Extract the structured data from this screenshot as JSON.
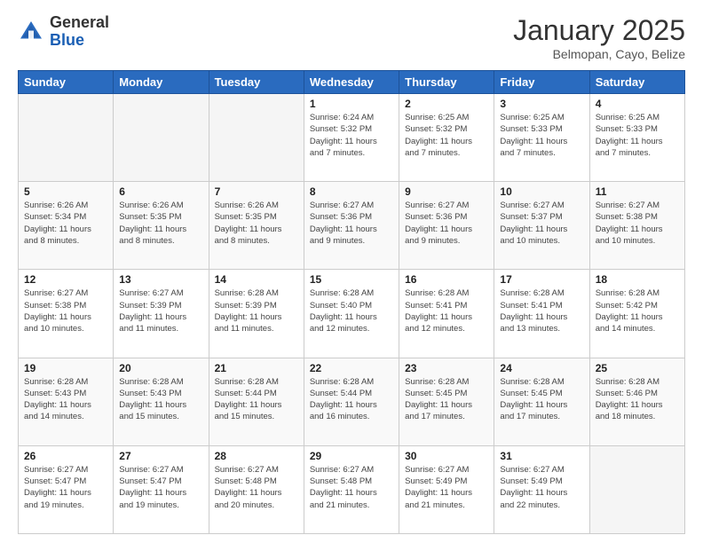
{
  "logo": {
    "general": "General",
    "blue": "Blue"
  },
  "title": "January 2025",
  "subtitle": "Belmopan, Cayo, Belize",
  "days_of_week": [
    "Sunday",
    "Monday",
    "Tuesday",
    "Wednesday",
    "Thursday",
    "Friday",
    "Saturday"
  ],
  "weeks": [
    [
      {
        "day": "",
        "info": ""
      },
      {
        "day": "",
        "info": ""
      },
      {
        "day": "",
        "info": ""
      },
      {
        "day": "1",
        "info": "Sunrise: 6:24 AM\nSunset: 5:32 PM\nDaylight: 11 hours and 7 minutes."
      },
      {
        "day": "2",
        "info": "Sunrise: 6:25 AM\nSunset: 5:32 PM\nDaylight: 11 hours and 7 minutes."
      },
      {
        "day": "3",
        "info": "Sunrise: 6:25 AM\nSunset: 5:33 PM\nDaylight: 11 hours and 7 minutes."
      },
      {
        "day": "4",
        "info": "Sunrise: 6:25 AM\nSunset: 5:33 PM\nDaylight: 11 hours and 7 minutes."
      }
    ],
    [
      {
        "day": "5",
        "info": "Sunrise: 6:26 AM\nSunset: 5:34 PM\nDaylight: 11 hours and 8 minutes."
      },
      {
        "day": "6",
        "info": "Sunrise: 6:26 AM\nSunset: 5:35 PM\nDaylight: 11 hours and 8 minutes."
      },
      {
        "day": "7",
        "info": "Sunrise: 6:26 AM\nSunset: 5:35 PM\nDaylight: 11 hours and 8 minutes."
      },
      {
        "day": "8",
        "info": "Sunrise: 6:27 AM\nSunset: 5:36 PM\nDaylight: 11 hours and 9 minutes."
      },
      {
        "day": "9",
        "info": "Sunrise: 6:27 AM\nSunset: 5:36 PM\nDaylight: 11 hours and 9 minutes."
      },
      {
        "day": "10",
        "info": "Sunrise: 6:27 AM\nSunset: 5:37 PM\nDaylight: 11 hours and 10 minutes."
      },
      {
        "day": "11",
        "info": "Sunrise: 6:27 AM\nSunset: 5:38 PM\nDaylight: 11 hours and 10 minutes."
      }
    ],
    [
      {
        "day": "12",
        "info": "Sunrise: 6:27 AM\nSunset: 5:38 PM\nDaylight: 11 hours and 10 minutes."
      },
      {
        "day": "13",
        "info": "Sunrise: 6:27 AM\nSunset: 5:39 PM\nDaylight: 11 hours and 11 minutes."
      },
      {
        "day": "14",
        "info": "Sunrise: 6:28 AM\nSunset: 5:39 PM\nDaylight: 11 hours and 11 minutes."
      },
      {
        "day": "15",
        "info": "Sunrise: 6:28 AM\nSunset: 5:40 PM\nDaylight: 11 hours and 12 minutes."
      },
      {
        "day": "16",
        "info": "Sunrise: 6:28 AM\nSunset: 5:41 PM\nDaylight: 11 hours and 12 minutes."
      },
      {
        "day": "17",
        "info": "Sunrise: 6:28 AM\nSunset: 5:41 PM\nDaylight: 11 hours and 13 minutes."
      },
      {
        "day": "18",
        "info": "Sunrise: 6:28 AM\nSunset: 5:42 PM\nDaylight: 11 hours and 14 minutes."
      }
    ],
    [
      {
        "day": "19",
        "info": "Sunrise: 6:28 AM\nSunset: 5:43 PM\nDaylight: 11 hours and 14 minutes."
      },
      {
        "day": "20",
        "info": "Sunrise: 6:28 AM\nSunset: 5:43 PM\nDaylight: 11 hours and 15 minutes."
      },
      {
        "day": "21",
        "info": "Sunrise: 6:28 AM\nSunset: 5:44 PM\nDaylight: 11 hours and 15 minutes."
      },
      {
        "day": "22",
        "info": "Sunrise: 6:28 AM\nSunset: 5:44 PM\nDaylight: 11 hours and 16 minutes."
      },
      {
        "day": "23",
        "info": "Sunrise: 6:28 AM\nSunset: 5:45 PM\nDaylight: 11 hours and 17 minutes."
      },
      {
        "day": "24",
        "info": "Sunrise: 6:28 AM\nSunset: 5:45 PM\nDaylight: 11 hours and 17 minutes."
      },
      {
        "day": "25",
        "info": "Sunrise: 6:28 AM\nSunset: 5:46 PM\nDaylight: 11 hours and 18 minutes."
      }
    ],
    [
      {
        "day": "26",
        "info": "Sunrise: 6:27 AM\nSunset: 5:47 PM\nDaylight: 11 hours and 19 minutes."
      },
      {
        "day": "27",
        "info": "Sunrise: 6:27 AM\nSunset: 5:47 PM\nDaylight: 11 hours and 19 minutes."
      },
      {
        "day": "28",
        "info": "Sunrise: 6:27 AM\nSunset: 5:48 PM\nDaylight: 11 hours and 20 minutes."
      },
      {
        "day": "29",
        "info": "Sunrise: 6:27 AM\nSunset: 5:48 PM\nDaylight: 11 hours and 21 minutes."
      },
      {
        "day": "30",
        "info": "Sunrise: 6:27 AM\nSunset: 5:49 PM\nDaylight: 11 hours and 21 minutes."
      },
      {
        "day": "31",
        "info": "Sunrise: 6:27 AM\nSunset: 5:49 PM\nDaylight: 11 hours and 22 minutes."
      },
      {
        "day": "",
        "info": ""
      }
    ]
  ]
}
